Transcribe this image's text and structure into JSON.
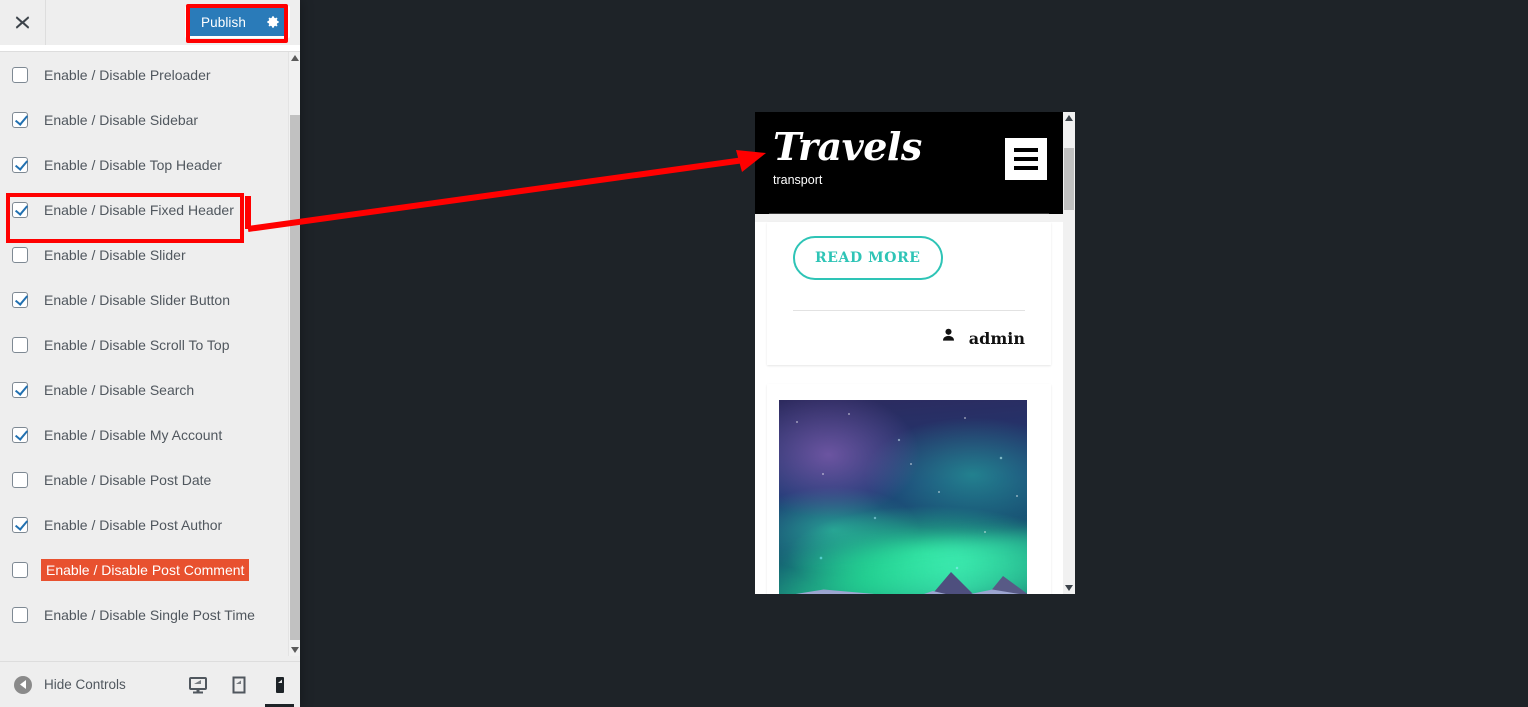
{
  "customizer": {
    "header": {
      "close_icon": "close-icon",
      "publish_label": "Publish",
      "publish_gear_icon": "gear-icon"
    },
    "controls": [
      {
        "label": "Enable / Disable Preloader",
        "checked": false,
        "highlighted": false,
        "annotated": false
      },
      {
        "label": "Enable / Disable Sidebar",
        "checked": true,
        "highlighted": false,
        "annotated": false
      },
      {
        "label": "Enable / Disable Top Header",
        "checked": true,
        "highlighted": false,
        "annotated": false
      },
      {
        "label": "Enable / Disable Fixed Header",
        "checked": true,
        "highlighted": false,
        "annotated": true
      },
      {
        "label": "Enable / Disable Slider",
        "checked": false,
        "highlighted": false,
        "annotated": false
      },
      {
        "label": "Enable / Disable Slider Button",
        "checked": true,
        "highlighted": false,
        "annotated": false
      },
      {
        "label": "Enable / Disable Scroll To Top",
        "checked": false,
        "highlighted": false,
        "annotated": false
      },
      {
        "label": "Enable / Disable Search",
        "checked": true,
        "highlighted": false,
        "annotated": false
      },
      {
        "label": "Enable / Disable My Account",
        "checked": true,
        "highlighted": false,
        "annotated": false
      },
      {
        "label": "Enable / Disable Post Date",
        "checked": false,
        "highlighted": false,
        "annotated": false
      },
      {
        "label": "Enable / Disable Post Author",
        "checked": true,
        "highlighted": false,
        "annotated": false
      },
      {
        "label": "Enable / Disable Post Comment",
        "checked": false,
        "highlighted": true,
        "annotated": false
      },
      {
        "label": "Enable / Disable Single Post Time",
        "checked": false,
        "highlighted": false,
        "annotated": false
      }
    ],
    "footer": {
      "hide_controls_label": "Hide Controls",
      "devices": [
        {
          "name": "desktop",
          "active": false
        },
        {
          "name": "tablet",
          "active": false
        },
        {
          "name": "mobile",
          "active": true
        }
      ]
    },
    "scrollbar": {
      "up_icon": "triangle-up-icon",
      "down_icon": "triangle-down-icon"
    }
  },
  "preview": {
    "site_title": "Travels",
    "tagline": "transport",
    "menu_icon": "hamburger-menu-icon",
    "read_more_label": "READ MORE",
    "author_name": "admin",
    "author_icon": "user-icon",
    "featured_image_alt": "aurora-borealis-over-snow",
    "scrollbar": {
      "up_icon": "triangle-up-icon",
      "down_icon": "triangle-down-icon"
    }
  },
  "annotations": {
    "publish_box_color": "#ff0000",
    "row_box_color": "#ff0000",
    "arrow_color": "#ff0000",
    "highlight_color": "#e8512f"
  },
  "colors": {
    "accent_blue": "#2a7bb9",
    "panel_bg": "#eeeeee",
    "page_bg": "#1e2328",
    "teal": "#2ec4b6",
    "topbar_black": "#000000"
  }
}
